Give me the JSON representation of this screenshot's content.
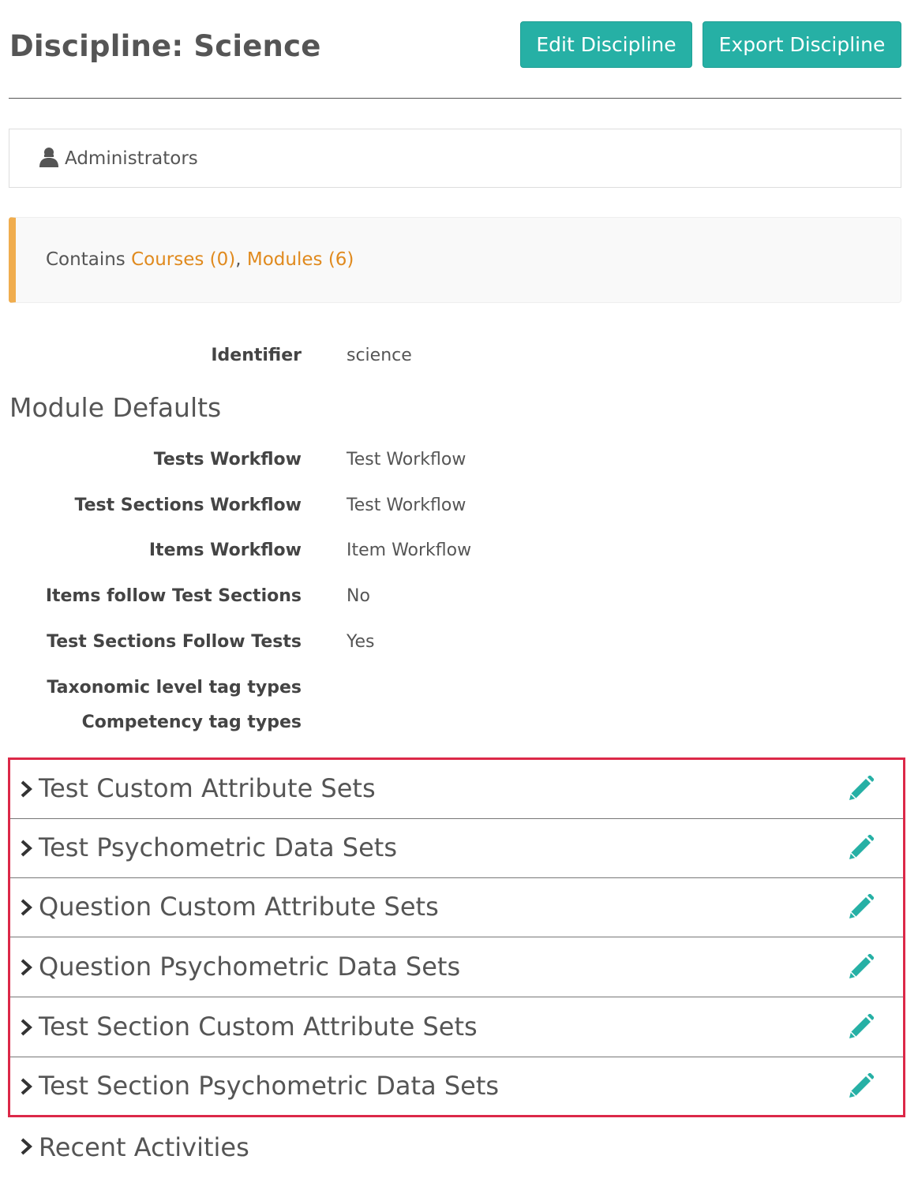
{
  "header": {
    "title": "Discipline: Science",
    "edit_button": "Edit Discipline",
    "export_button": "Export Discipline"
  },
  "admins": {
    "label": "Administrators",
    "icon": "user-icon"
  },
  "contains": {
    "prefix": "Contains ",
    "courses_link": "Courses (0)",
    "separator": ", ",
    "modules_link": "Modules (6)"
  },
  "identifier": {
    "label": "Identifier",
    "value": "science"
  },
  "module_defaults": {
    "heading": "Module Defaults",
    "rows": [
      {
        "label": "Tests Workflow",
        "value": "Test Workflow"
      },
      {
        "label": "Test Sections Workflow",
        "value": "Test Workflow"
      },
      {
        "label": "Items Workflow",
        "value": "Item Workflow"
      },
      {
        "label": "Items follow Test Sections",
        "value": "No"
      },
      {
        "label": "Test Sections Follow Tests",
        "value": "Yes"
      },
      {
        "label": "Taxonomic level tag types",
        "value": ""
      },
      {
        "label": "Competency tag types",
        "value": ""
      }
    ]
  },
  "panels": [
    {
      "title": "Test Custom Attribute Sets",
      "icon": "pencil-icon"
    },
    {
      "title": "Test Psychometric Data Sets",
      "icon": "pencil-icon"
    },
    {
      "title": "Question Custom Attribute Sets",
      "icon": "pencil-icon"
    },
    {
      "title": "Question Psychometric Data Sets",
      "icon": "pencil-icon"
    },
    {
      "title": "Test Section Custom Attribute Sets",
      "icon": "pencil-icon"
    },
    {
      "title": "Test Section Psychometric Data Sets",
      "icon": "pencil-icon"
    }
  ],
  "recent": {
    "title": "Recent Activities"
  },
  "colors": {
    "accent": "#26b0a5",
    "link": "#e08a1e",
    "callout_border": "#f0ad4e",
    "highlight_border": "#dc2848"
  }
}
